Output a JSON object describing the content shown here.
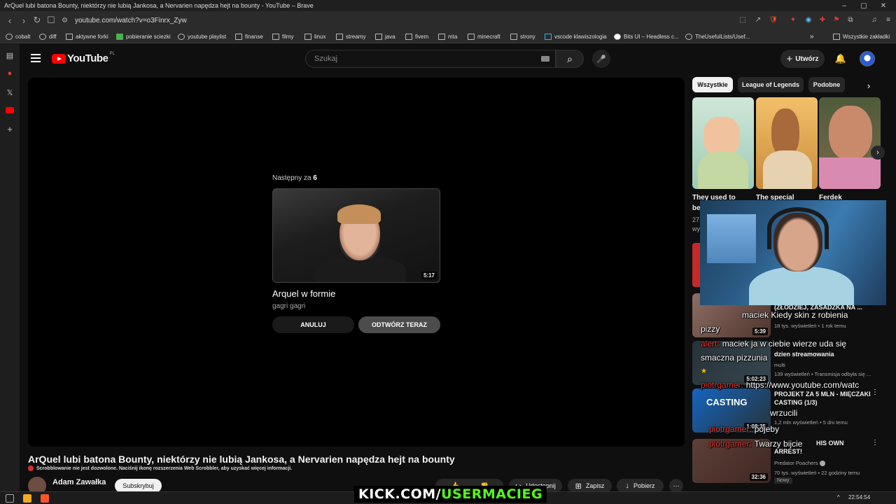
{
  "window": {
    "title": "ArQuel lubi batona Bounty, niektórzy nie lubią Jankosa, a Nervarien napędza hejt na bounty - YouTube – Brave",
    "minimize": "–",
    "maximize": "▢",
    "close": "✕"
  },
  "browser": {
    "url": "youtube.com/watch?v=o3Finrx_Zyw",
    "overflow": "»",
    "all_bookmarks": "Wszystkie zakładki"
  },
  "bookmarks": [
    {
      "label": "cobalt"
    },
    {
      "label": "diff"
    },
    {
      "label": "aktywne forki"
    },
    {
      "label": "pobieranie sciezki"
    },
    {
      "label": "youtube playlist"
    },
    {
      "label": "finanse"
    },
    {
      "label": "filmy"
    },
    {
      "label": "linux"
    },
    {
      "label": "streamy"
    },
    {
      "label": "java"
    },
    {
      "label": "fivem"
    },
    {
      "label": "mta"
    },
    {
      "label": "minecraft"
    },
    {
      "label": "strony"
    },
    {
      "label": "vscode klawiszologia"
    },
    {
      "label": "Bits UI – Headless c..."
    },
    {
      "label": "TheUsefulLists/Usef..."
    }
  ],
  "header": {
    "logo_text": "YouTube",
    "country_code": "PL",
    "search_placeholder": "Szukaj",
    "create_label": "Utwórz"
  },
  "upnext": {
    "label": "Następny za",
    "countdown": "6",
    "title": "Arquel w formie",
    "channel": "gagri gagri",
    "duration": "5:17",
    "cancel": "ANULUJ",
    "play_now": "ODTWÓRZ TERAZ"
  },
  "video": {
    "title": "ArQuel lubi batona Bounty, niektórzy nie lubią Jankosa, a Nervarien napędza hejt na bounty",
    "scrobble_note": "Scrobblowanie nie jest dozwolone. Naciśnij ikonę rozszerzenia Web Scrobbler, aby uzyskać więcej informacji.",
    "channel_name": "Adam Zawałka",
    "subscribe": "Subskrybuj",
    "share": "Udostępnij",
    "save": "Zapisz",
    "download": "Pobierz"
  },
  "chips": [
    {
      "label": "Wszystkie",
      "active": true
    },
    {
      "label": "League of Legends"
    },
    {
      "label": "Podobne"
    }
  ],
  "shorts": [
    {
      "title": "They used to"
    },
    {
      "title": "The special"
    },
    {
      "title": "Ferdek"
    }
  ],
  "shorts_partial": {
    "line2": "be",
    "line3": "27",
    "line4": "wy"
  },
  "sidebar": [
    {
      "title": "(ZŁODZIEJ, ZASADZKA NA ...",
      "meta1": "18 tys. wyświetleń • 1 rok temu",
      "duration": "5:39"
    },
    {
      "title": "dzien streamowania",
      "meta0": "multi",
      "meta1": "139 wyświetleń • Transmisja odbyła się ...",
      "duration": "5:02:23"
    },
    {
      "title": "PROJEKT ZA 5 MLN - MIĘCZAKI CASTING (1/3)",
      "meta1": "1,2 mln wyświetleń • 5 dni temu",
      "duration": "1:08:35"
    },
    {
      "title": "HIS OWN ARREST!",
      "meta0": "Predator Poachers",
      "meta1": "70 tys. wyświetleń • 22 godziny temu",
      "badge": "Nowy",
      "duration": "32:36"
    }
  ],
  "chat": [
    {
      "user": "",
      "text": "maciek Kiedy skin z robienia"
    },
    {
      "user": "",
      "text": "pizzy"
    },
    {
      "user": "alert:",
      "text": "maciek ja w ciebie wierze uda się"
    },
    {
      "user": "",
      "text": "smaczna pizzunia"
    },
    {
      "user": "piotrgamer:",
      "text": "https://www.youtube.com/watc"
    },
    {
      "user": "",
      "text": "wrzucili"
    },
    {
      "user": "piotrgamer:",
      "text": "pojeby"
    },
    {
      "user": "piotrgamer:",
      "text": "Twarzy bijcie"
    }
  ],
  "overlay": {
    "kick_white": "KICK.COM/",
    "kick_green": "USERMACIEG"
  },
  "taskbar": {
    "time": "22:54:54",
    "chevron": "^"
  },
  "colors": {
    "accent": "#ff0000",
    "kick_green": "#53fc18"
  }
}
